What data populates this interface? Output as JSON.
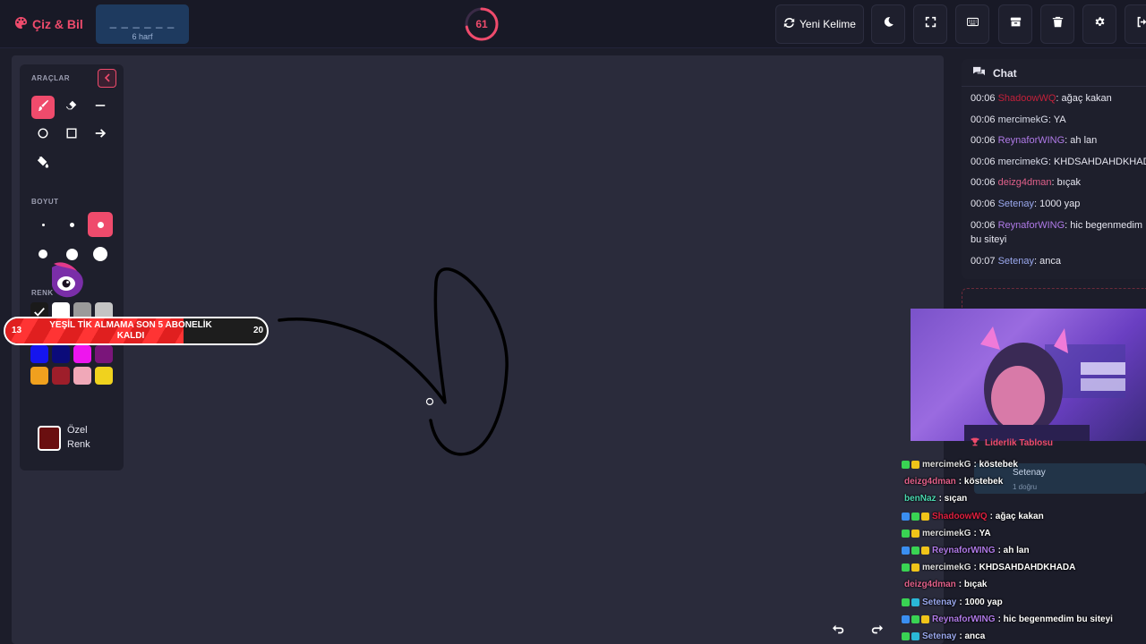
{
  "app": {
    "name": "Çiz & Bil"
  },
  "word": {
    "dashes": "_ _ _ _ _ _",
    "count_label": "6 harf"
  },
  "timer": {
    "value": "61",
    "fraction": 0.72
  },
  "topbar": {
    "new_word_label": "Yeni Kelime"
  },
  "tools": {
    "title": "ARAÇLAR",
    "size_title": "BOYUT",
    "color_title": "RENK",
    "custom_color_label": "Özel Renk",
    "active_tool": "brush",
    "active_size": 3,
    "palette": [
      "#ffffff",
      "#9a9a9a",
      "#c4c4c4",
      "#22ee22",
      "#148a14",
      "#22eeee",
      "#0e8a8a",
      "#1515ee",
      "#0b0b7a",
      "#ee15ee",
      "#7a157a",
      "#f0a01e",
      "#9e1e2a",
      "#f0a8b8",
      "#f0d21e"
    ],
    "custom_color": "#6a0f10"
  },
  "goal": {
    "start": "13",
    "text": "YEŞİL TİK ALMAMA SON 5 ABONELİK KALDI",
    "end": "20",
    "progress": 0.68
  },
  "chat": {
    "title": "Chat",
    "messages": [
      {
        "time": "00:06",
        "user": "ShadoowWQ",
        "color": "#c4203a",
        "text": "ağaç kakan"
      },
      {
        "time": "00:06",
        "user": "mercimekG",
        "color": "#d8dbe8",
        "text": "YA"
      },
      {
        "time": "00:06",
        "user": "ReynaforWING",
        "color": "#b07ae8",
        "text": "ah lan"
      },
      {
        "time": "00:06",
        "user": "mercimekG",
        "color": "#d8dbe8",
        "text": "KHDSAHDAHDKHADA"
      },
      {
        "time": "00:06",
        "user": "deizg4dman",
        "color": "#e0608a",
        "text": "bıçak"
      },
      {
        "time": "00:06",
        "user": "Setenay",
        "color": "#9aa8ee",
        "text": "1000 yap"
      },
      {
        "time": "00:06",
        "user": "ReynaforWING",
        "color": "#b07ae8",
        "text": "hic begenmedim bu siteyi"
      },
      {
        "time": "00:07",
        "user": "Setenay",
        "color": "#9aa8ee",
        "text": "anca"
      }
    ]
  },
  "leaderboard": {
    "title": "Liderlik Tablosu",
    "entries": [
      {
        "name": "Setenay",
        "score": "1 doğru"
      }
    ]
  },
  "overlay_chat": [
    {
      "user": "mercimekG",
      "color": "#e0e0e0",
      "text": "köstebek",
      "badges": [
        "#39d353",
        "#f0c419"
      ]
    },
    {
      "user": "deizg4dman",
      "color": "#e0608a",
      "text": "köstebek",
      "badges": []
    },
    {
      "user": "benNaz",
      "color": "#4ad8b0",
      "text": "sıçan",
      "badges": []
    },
    {
      "user": "ShadoowWQ",
      "color": "#e02040",
      "text": "ağaç kakan",
      "badges": [
        "#3a8ef0",
        "#39d353",
        "#f0c419"
      ]
    },
    {
      "user": "mercimekG",
      "color": "#e0e0e0",
      "text": "YA",
      "badges": [
        "#39d353",
        "#f0c419"
      ]
    },
    {
      "user": "ReynaforWING",
      "color": "#b07ae8",
      "text": "ah lan",
      "badges": [
        "#3a8ef0",
        "#39d353",
        "#f0c419"
      ]
    },
    {
      "user": "mercimekG",
      "color": "#e0e0e0",
      "text": "KHDSAHDAHDKHADA",
      "badges": [
        "#39d353",
        "#f0c419"
      ]
    },
    {
      "user": "deizg4dman",
      "color": "#e0608a",
      "text": "bıçak",
      "badges": []
    },
    {
      "user": "Setenay",
      "color": "#9aa8ee",
      "text": "1000 yap",
      "badges": [
        "#39d353",
        "#2ab8d8"
      ]
    },
    {
      "user": "ReynaforWING",
      "color": "#b07ae8",
      "text": "hic begenmedim bu siteyi",
      "badges": [
        "#3a8ef0",
        "#39d353",
        "#f0c419"
      ]
    },
    {
      "user": "Setenay",
      "color": "#9aa8ee",
      "text": "anca",
      "badges": [
        "#39d353",
        "#2ab8d8"
      ]
    }
  ],
  "icons": [
    "palette-icon",
    "refresh-icon",
    "moon-icon",
    "fullscreen-icon",
    "keyboard-icon",
    "archive-icon",
    "trash-icon",
    "gear-icon",
    "logout-icon",
    "chat-icon",
    "trophy-icon",
    "brush-icon",
    "eraser-icon",
    "line-icon",
    "circle-icon",
    "rectangle-icon",
    "arrow-icon",
    "fill-bucket-icon",
    "undo-icon",
    "redo-icon"
  ]
}
